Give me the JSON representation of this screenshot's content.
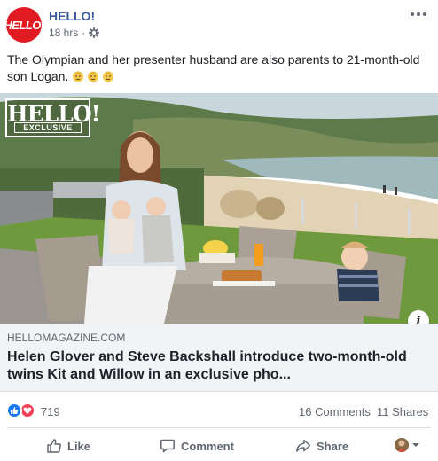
{
  "post": {
    "page_name": "HELLO!",
    "page_logo_text": "HELLO!",
    "time": "18 hrs",
    "separator": "·",
    "text": "The Olympian and her presenter husband are also parents to 21-month-old son Logan.",
    "emojis": [
      "baby-face-emoji",
      "baby-face-emoji",
      "baby-face-emoji"
    ]
  },
  "photo": {
    "badge_brand": "HELLO!",
    "badge_tag": "EXCLUSIVE"
  },
  "link_preview": {
    "domain": "HELLOMAGAZINE.COM",
    "title": "Helen Glover and Steve Backshall introduce two-month-old twins Kit and Willow in an exclusive pho..."
  },
  "reactions": {
    "count": "719",
    "comments": "16 Comments",
    "shares": "11 Shares"
  },
  "actions": {
    "like": "Like",
    "comment": "Comment",
    "share": "Share"
  },
  "colors": {
    "brand_red": "#e01b22",
    "link_blue": "#385898",
    "like_blue": "#1877f2",
    "love_red": "#f33e58"
  },
  "icons": [
    "globe-settings-icon",
    "more-options-icon",
    "info-icon",
    "like-icon",
    "comment-icon",
    "share-icon",
    "chevron-down-icon"
  ]
}
